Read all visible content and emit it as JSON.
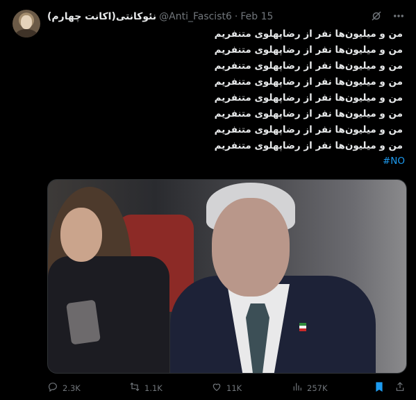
{
  "author": {
    "name": "نئوکانتی(اکانت چهارم)",
    "handle": "@Anti_Fascist6",
    "separator": "·",
    "date": "Feb 15"
  },
  "tweet": {
    "lines": [
      "من و میلیون‌ها نفر از رضاپهلوی متنفریم",
      "من و میلیون‌ها نفر از رضاپهلوی متنفریم",
      "من و میلیون‌ها نفر از رضاپهلوی متنفریم",
      "من و میلیون‌ها نفر از رضاپهلوی متنفریم",
      "من و میلیون‌ها نفر از رضاپهلوی متنفریم",
      "من و میلیون‌ها نفر از رضاپهلوی متنفریم",
      "من و میلیون‌ها نفر از رضاپهلوی متنفریم",
      "من و میلیون‌ها نفر از رضاپهلوی متنفریم"
    ],
    "hashtag": "#NO"
  },
  "actions": {
    "replies": "2.3K",
    "reposts": "1.1K",
    "likes": "11K",
    "views": "257K"
  },
  "icons": {
    "top": [
      "grok-icon",
      "more-icon"
    ],
    "actions": [
      "reply-icon",
      "repost-icon",
      "like-icon",
      "views-icon",
      "bookmark-icon",
      "share-icon"
    ]
  },
  "colors": {
    "accent": "#1d9bf0",
    "muted": "#71767b",
    "text": "#e7e9ea",
    "background": "#000000"
  }
}
